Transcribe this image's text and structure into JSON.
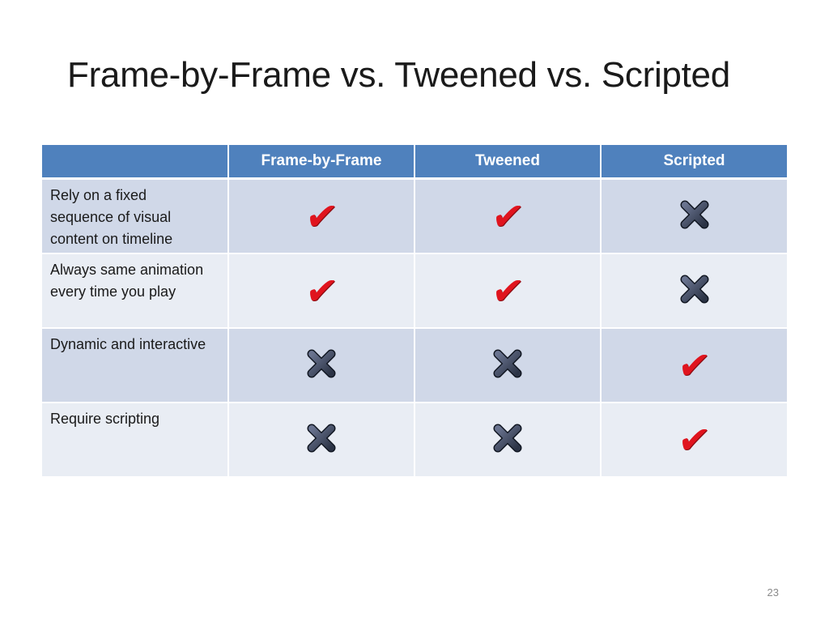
{
  "slide": {
    "title": "Frame-by-Frame vs. Tweened vs. Scripted",
    "page_number": "23"
  },
  "table": {
    "headers": [
      "",
      "Frame-by-Frame",
      "Tweened",
      "Scripted"
    ],
    "rows": [
      {
        "label": "Rely on a fixed sequence of visual content on timeline",
        "values": [
          "check",
          "check",
          "cross"
        ]
      },
      {
        "label": "Always same animation every time you play",
        "values": [
          "check",
          "check",
          "cross"
        ]
      },
      {
        "label": "Dynamic and interactive",
        "values": [
          "cross",
          "cross",
          "check"
        ]
      },
      {
        "label": "Require scripting",
        "values": [
          "cross",
          "cross",
          "check"
        ]
      }
    ]
  },
  "icons": {
    "check": {
      "glyph": "✔",
      "name": "checkmark-icon",
      "color": "#e0141e"
    },
    "cross": {
      "name": "x-mark-icon",
      "color": "#2b3345"
    }
  },
  "colors": {
    "header_bg": "#4f81bd",
    "row_odd": "#d0d8e8",
    "row_even": "#e9edf4"
  }
}
